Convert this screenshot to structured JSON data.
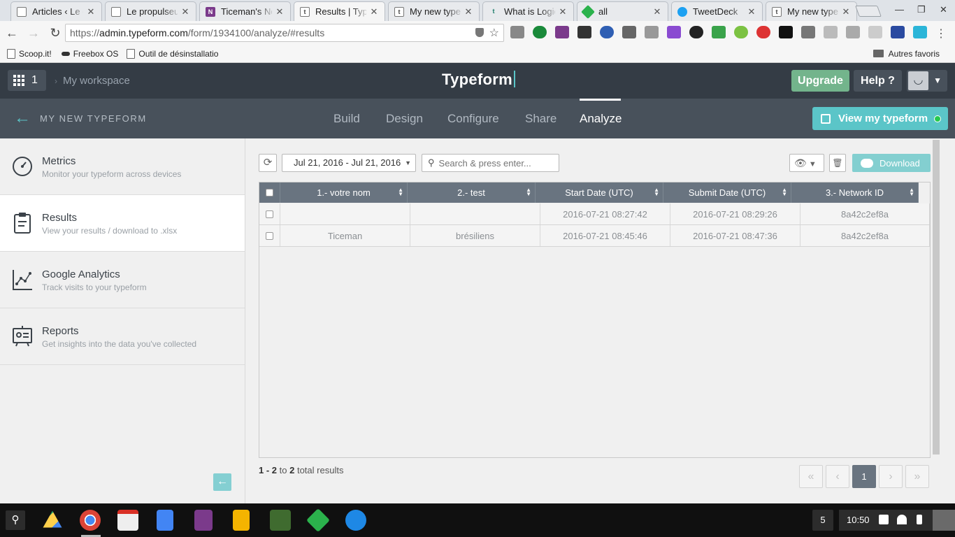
{
  "browser": {
    "tabs": [
      {
        "title": "Articles ‹ Le co",
        "favicon": "page-icon",
        "active": false
      },
      {
        "title": "Le propulseur",
        "favicon": "page-icon",
        "active": false
      },
      {
        "title": "Ticeman's No",
        "favicon": "onenote-icon",
        "active": false
      },
      {
        "title": "Results | Type",
        "favicon": "typeform-icon",
        "active": true
      },
      {
        "title": "My new typefo",
        "favicon": "typeform-icon",
        "active": false
      },
      {
        "title": "What is Logic",
        "favicon": "typeform-icon",
        "active": false
      },
      {
        "title": "all",
        "favicon": "feedly-icon",
        "active": false
      },
      {
        "title": "TweetDeck",
        "favicon": "twitter-icon",
        "active": false
      },
      {
        "title": "My new typefo",
        "favicon": "typeform-icon",
        "active": false
      }
    ],
    "url_prefix": "https://",
    "url_host": "admin.typeform.com",
    "url_path": "/form/1934100/analyze/#results",
    "bookmarks": [
      "Scoop.it!",
      "Freebox OS",
      "Outil de désinstallatio"
    ],
    "other_bookmarks": "Autres favoris"
  },
  "header": {
    "apps_count": "1",
    "workspace": "My workspace",
    "brand": "Typeform",
    "upgrade_label": "Upgrade",
    "help_label": "Help ?"
  },
  "subnav": {
    "form_name": "MY NEW TYPEFORM",
    "tabs": [
      "Build",
      "Design",
      "Configure",
      "Share",
      "Analyze"
    ],
    "active_tab": "Analyze",
    "view_label": "View my typeform"
  },
  "sidebar": {
    "items": [
      {
        "title": "Metrics",
        "desc": "Monitor your typeform across devices",
        "icon": "speedometer-icon"
      },
      {
        "title": "Results",
        "desc": "View your results / download to .xlsx",
        "icon": "clipboard-icon"
      },
      {
        "title": "Google Analytics",
        "desc": "Track visits to your typeform",
        "icon": "analytics-chart-icon"
      },
      {
        "title": "Reports",
        "desc": "Get insights into the data you've collected",
        "icon": "presentation-icon"
      }
    ],
    "active_index": 1
  },
  "results": {
    "date_range": "Jul 21, 2016 - Jul 21, 2016",
    "search_placeholder": "Search & press enter...",
    "download_label": "Download",
    "columns": [
      "1.- votre nom",
      "2.- test",
      "Start Date (UTC)",
      "Submit Date (UTC)",
      "3.- Network ID"
    ],
    "rows": [
      [
        "",
        "",
        "2016-07-21 08:27:42",
        "2016-07-21 08:29:26",
        "8a42c2ef8a"
      ],
      [
        "Ticeman",
        "brésiliens",
        "2016-07-21 08:45:46",
        "2016-07-21 08:47:36",
        "8a42c2ef8a"
      ]
    ],
    "count_range": "1 - 2",
    "count_to": "to",
    "count_total": "2",
    "count_suffix": "total results",
    "pager": {
      "first": "«",
      "prev": "‹",
      "current": "1",
      "next": "›",
      "last": "»"
    }
  },
  "taskbar": {
    "notifications": "5",
    "time": "10:50"
  },
  "colors": {
    "header_bg": "#343c45",
    "subnav_bg": "#48515b",
    "accent": "#5bc5c8",
    "upgrade": "#73b48c",
    "table_header": "#697480"
  }
}
